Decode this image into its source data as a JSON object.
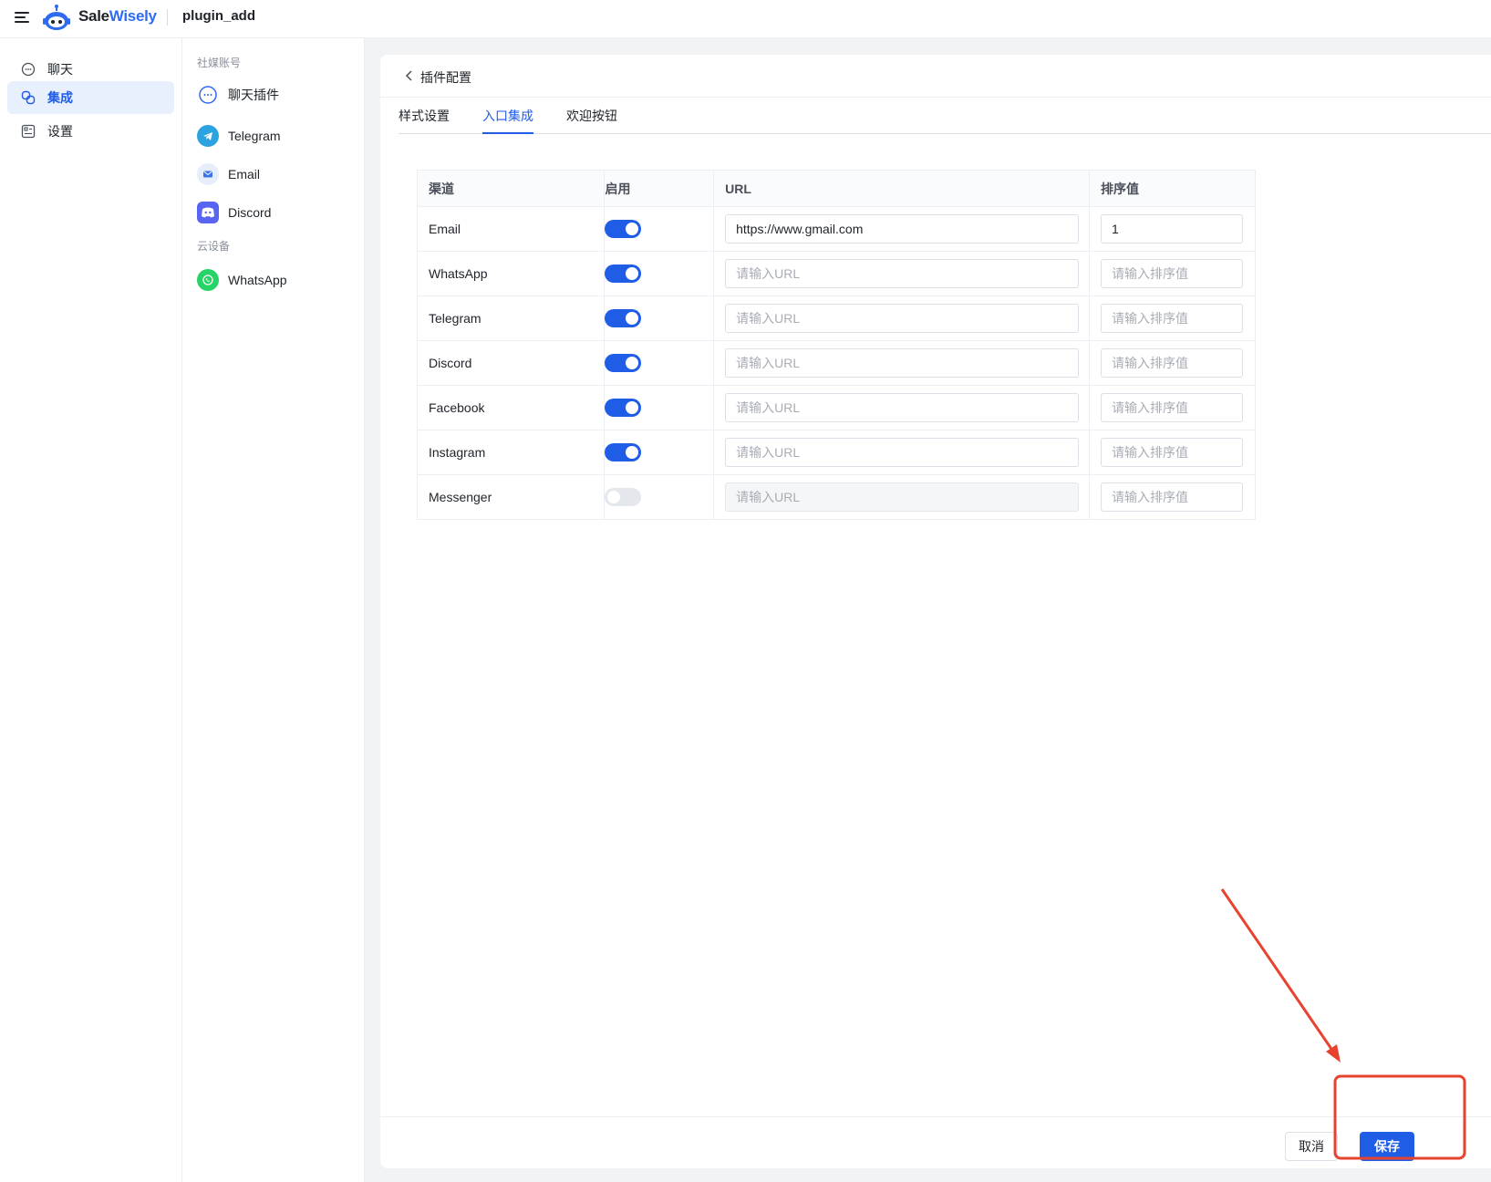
{
  "app": {
    "brand_part1": "Sale",
    "brand_part2": "Wisely",
    "page_name": "plugin_add"
  },
  "left_nav": {
    "items": [
      {
        "label": "聊天",
        "icon": "chat-bubble-icon",
        "active": false
      },
      {
        "label": "集成",
        "icon": "integration-icon",
        "active": true
      },
      {
        "label": "设置",
        "icon": "settings-icon",
        "active": false
      }
    ]
  },
  "sub_nav": {
    "group1_label": "社媒账号",
    "group2_label": "云设备",
    "items": [
      {
        "label": "聊天插件",
        "icon": "chat-plugin-icon"
      },
      {
        "label": "Telegram",
        "icon": "telegram-icon"
      },
      {
        "label": "Email",
        "icon": "email-icon"
      },
      {
        "label": "Discord",
        "icon": "discord-icon"
      },
      {
        "label": "WhatsApp",
        "icon": "whatsapp-icon"
      }
    ]
  },
  "card": {
    "title": "插件配置",
    "tabs": [
      {
        "label": "样式设置",
        "active": false
      },
      {
        "label": "入口集成",
        "active": true
      },
      {
        "label": "欢迎按钮",
        "active": false
      }
    ]
  },
  "table": {
    "headers": [
      "渠道",
      "启用",
      "URL",
      "排序值"
    ],
    "url_placeholder": "请输入URL",
    "sort_placeholder": "请输入排序值",
    "rows": [
      {
        "channel": "Email",
        "enabled": true,
        "url": "https://www.gmail.com",
        "sort": "1"
      },
      {
        "channel": "WhatsApp",
        "enabled": true,
        "url": "",
        "sort": ""
      },
      {
        "channel": "Telegram",
        "enabled": true,
        "url": "",
        "sort": ""
      },
      {
        "channel": "Discord",
        "enabled": true,
        "url": "",
        "sort": ""
      },
      {
        "channel": "Facebook",
        "enabled": true,
        "url": "",
        "sort": ""
      },
      {
        "channel": "Instagram",
        "enabled": true,
        "url": "",
        "sort": ""
      },
      {
        "channel": "Messenger",
        "enabled": false,
        "url": "",
        "sort": ""
      }
    ]
  },
  "footer": {
    "cancel_label": "取消",
    "save_label": "保存"
  },
  "colors": {
    "accent": "#1f5de6",
    "annotation": "#e8432f"
  }
}
